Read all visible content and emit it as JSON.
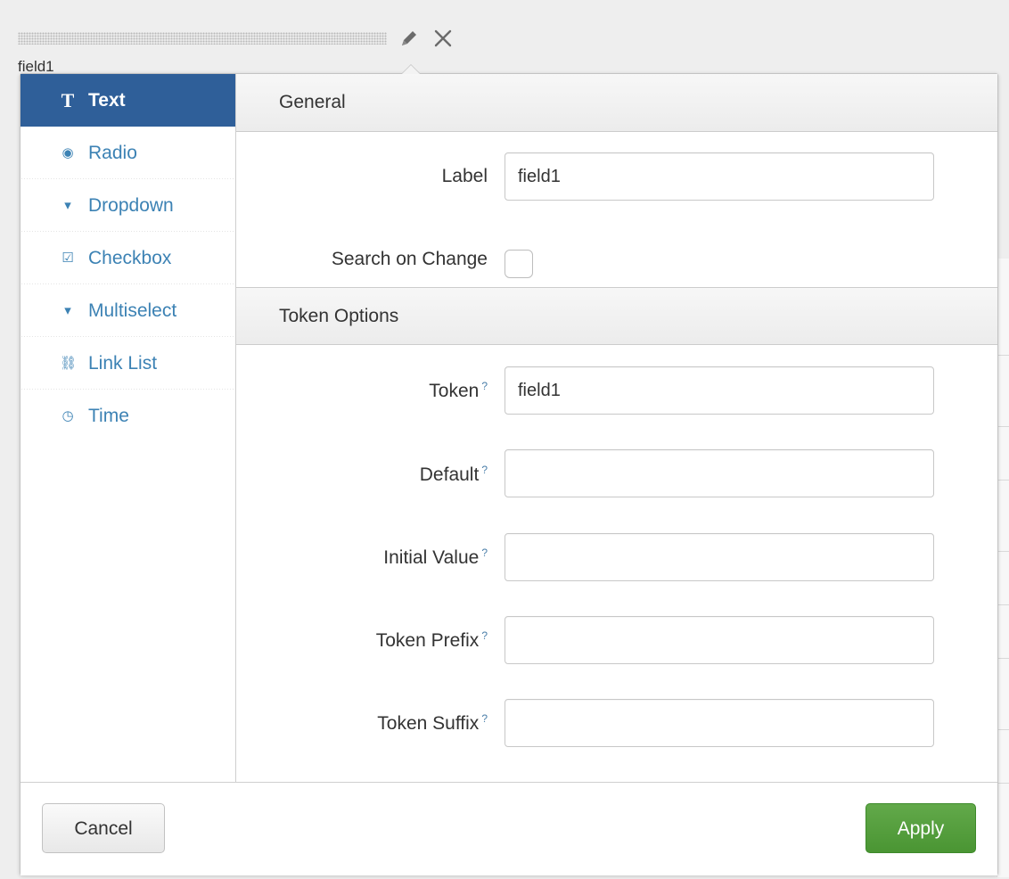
{
  "background": {
    "field_label": "field1"
  },
  "sidebar": {
    "items": [
      {
        "label": "Text",
        "icon": "T"
      },
      {
        "label": "Radio",
        "icon": "◉"
      },
      {
        "label": "Dropdown",
        "icon": "▾"
      },
      {
        "label": "Checkbox",
        "icon": "☑"
      },
      {
        "label": "Multiselect",
        "icon": "▾"
      },
      {
        "label": "Link List",
        "icon": "⛓"
      },
      {
        "label": "Time",
        "icon": "◷"
      }
    ],
    "active_index": 0
  },
  "general": {
    "header": "General",
    "label_label": "Label",
    "label_value": "field1",
    "search_on_change_label": "Search on Change",
    "search_on_change_checked": false
  },
  "token_options": {
    "header": "Token Options",
    "help_mark": "?",
    "token_label": "Token",
    "token_value": "field1",
    "default_label": "Default",
    "default_value": "",
    "initial_value_label": "Initial Value",
    "initial_value_value": "",
    "token_prefix_label": "Token Prefix",
    "token_prefix_value": "",
    "token_suffix_label": "Token Suffix",
    "token_suffix_value": ""
  },
  "footer": {
    "cancel_label": "Cancel",
    "apply_label": "Apply"
  },
  "colors": {
    "active_tab": "#2f5f99",
    "link": "#3c82b4",
    "apply": "#4f9a38"
  }
}
